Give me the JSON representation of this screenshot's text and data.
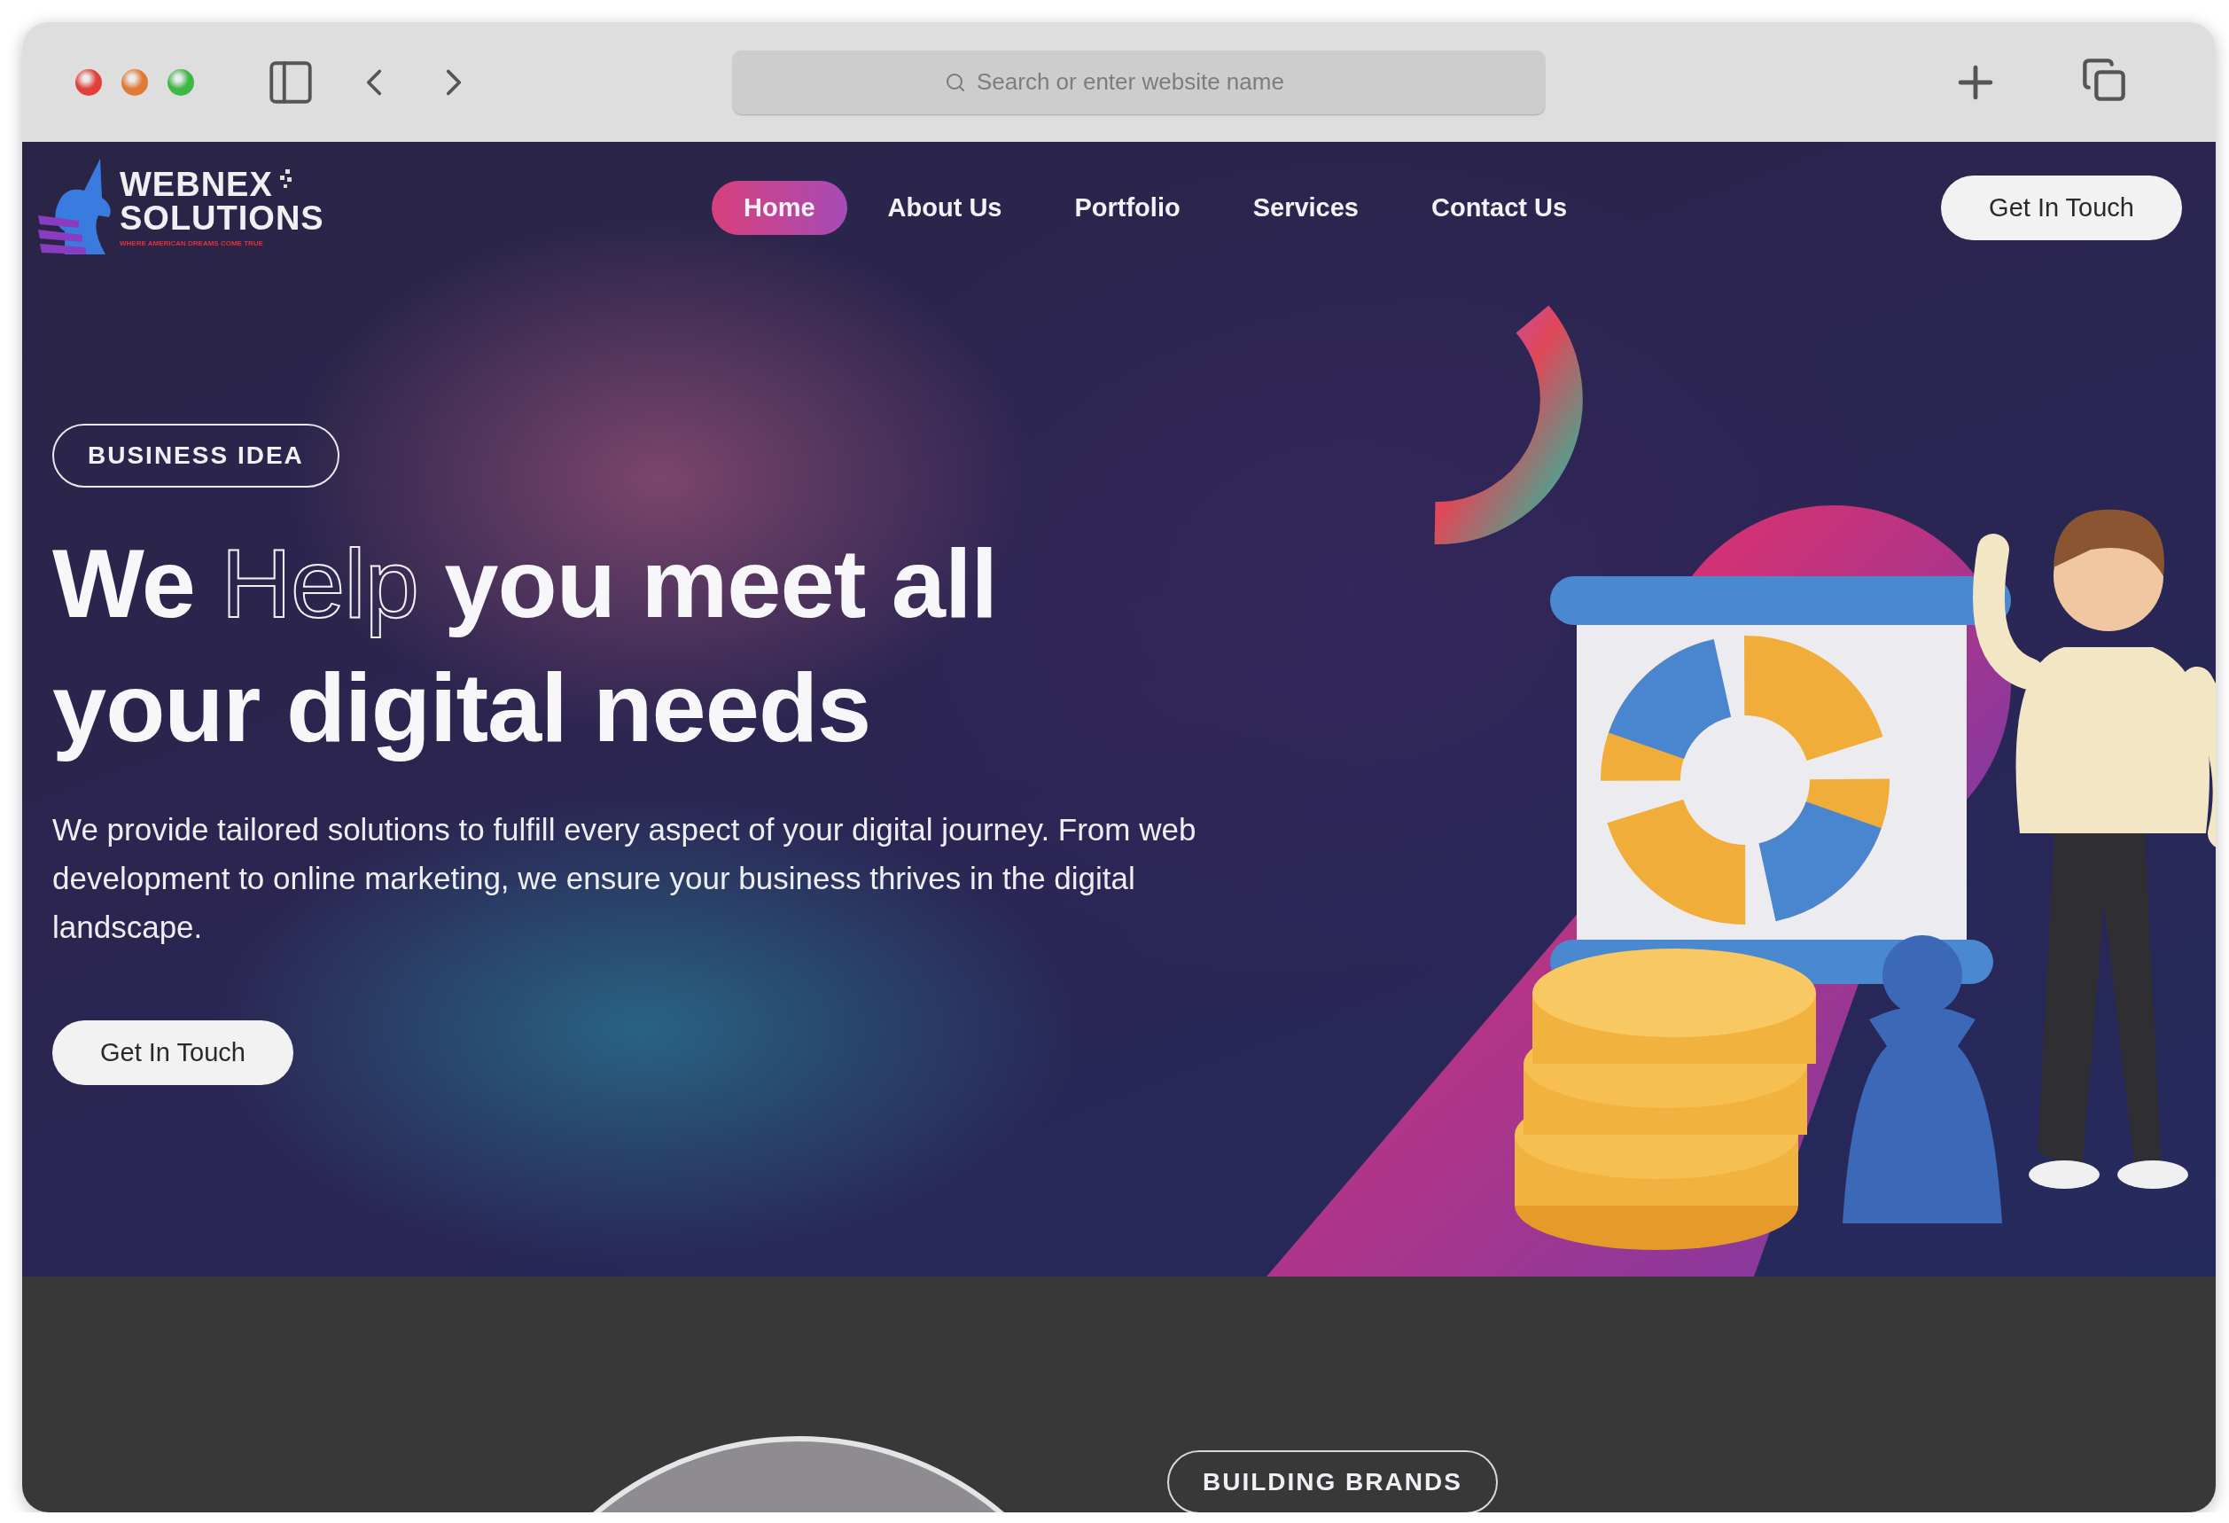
{
  "browser": {
    "address_placeholder": "Search or enter website name"
  },
  "header": {
    "logo": {
      "line1": "WEBNEX",
      "line2": "SOLUTIONS",
      "tagline": "WHERE AMERICAN DREAMS COME TRUE"
    },
    "nav": [
      {
        "label": "Home",
        "selected": true
      },
      {
        "label": "About Us",
        "selected": false
      },
      {
        "label": "Portfolio",
        "selected": false
      },
      {
        "label": "Services",
        "selected": false
      },
      {
        "label": "Contact Us",
        "selected": false
      }
    ],
    "cta": "Get In Touch"
  },
  "hero": {
    "badge": "BUSINESS IDEA",
    "heading_lines": [
      [
        {
          "text": "We ",
          "kind": "solid"
        },
        {
          "text": "Help",
          "kind": "outline"
        },
        {
          "text": " you meet all",
          "kind": "solid"
        }
      ],
      [
        {
          "text": "your digital needs",
          "kind": "solid"
        }
      ]
    ],
    "body": "We provide tailored solutions to fulfill every aspect of your digital journey. From web development to online marketing, we ensure your business thrives in the digital landscape.",
    "button": "Get In Touch"
  },
  "next_section": {
    "badge": "BUILDING BRANDS"
  }
}
